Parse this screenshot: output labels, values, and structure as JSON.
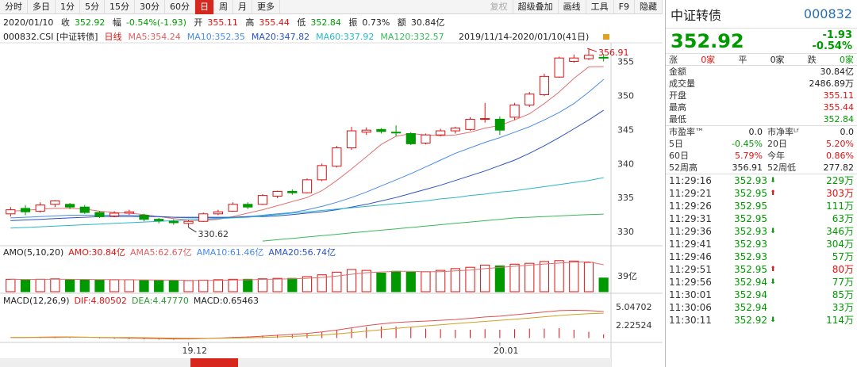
{
  "toolbar": {
    "items": [
      "分时",
      "多日",
      "1分",
      "5分",
      "15分",
      "30分",
      "60分",
      "日",
      "周",
      "月",
      "更多"
    ],
    "right": [
      "复权",
      "超级叠加",
      "画线",
      "工具",
      "F9",
      "隐藏"
    ]
  },
  "info": {
    "date": "2020/01/10",
    "close_label": "收",
    "close": "352.92",
    "range_label": "幅",
    "range": "-0.54%(-1.93)",
    "open_label": "开",
    "open": "355.11",
    "high_label": "高",
    "high": "355.44",
    "low_label": "低",
    "low": "352.84",
    "amp_label": "振",
    "amp": "0.73%",
    "amt_label": "额",
    "amt": "30.84亿"
  },
  "ma": {
    "code": "000832.CSI [中证转债]",
    "type": "日线",
    "ma5": "MA5:354.24",
    "ma10": "MA10:352.35",
    "ma20": "MA20:347.82",
    "ma60": "MA60:337.92",
    "ma120": "MA120:332.57",
    "range": "2019/11/14-2020/01/10(41日)"
  },
  "chart_data": {
    "type": "candlestick",
    "y_ticks": [
      355,
      350,
      345,
      340,
      335,
      330
    ],
    "ylim": [
      328.5,
      357.5
    ],
    "max_label": "356.91",
    "min_label": "330.62",
    "candles": [
      {
        "o": 332.6,
        "c": 333.2,
        "h": 333.6,
        "l": 332.2
      },
      {
        "o": 333.4,
        "c": 332.9,
        "h": 333.9,
        "l": 332.4
      },
      {
        "o": 333.0,
        "c": 333.9,
        "h": 334.3,
        "l": 332.8
      },
      {
        "o": 334.0,
        "c": 334.5,
        "h": 334.6,
        "l": 333.6
      },
      {
        "o": 334.0,
        "c": 333.6,
        "h": 334.2,
        "l": 333.3
      },
      {
        "o": 333.6,
        "c": 332.8,
        "h": 333.9,
        "l": 332.6
      },
      {
        "o": 332.8,
        "c": 332.2,
        "h": 333.0,
        "l": 332.0
      },
      {
        "o": 332.3,
        "c": 332.7,
        "h": 333.0,
        "l": 332.1
      },
      {
        "o": 332.7,
        "c": 332.9,
        "h": 333.2,
        "l": 332.4
      },
      {
        "o": 332.4,
        "c": 331.8,
        "h": 332.6,
        "l": 331.5
      },
      {
        "o": 331.8,
        "c": 331.6,
        "h": 332.0,
        "l": 331.2
      },
      {
        "o": 331.5,
        "c": 331.3,
        "h": 331.8,
        "l": 331.0
      },
      {
        "o": 331.2,
        "c": 331.5,
        "h": 331.7,
        "l": 330.6
      },
      {
        "o": 331.5,
        "c": 332.6,
        "h": 332.8,
        "l": 331.4
      },
      {
        "o": 332.6,
        "c": 332.9,
        "h": 333.2,
        "l": 332.4
      },
      {
        "o": 333.0,
        "c": 334.0,
        "h": 334.3,
        "l": 332.9
      },
      {
        "o": 334.0,
        "c": 333.6,
        "h": 334.3,
        "l": 333.3
      },
      {
        "o": 334.0,
        "c": 335.3,
        "h": 335.5,
        "l": 333.9
      },
      {
        "o": 335.2,
        "c": 335.9,
        "h": 336.0,
        "l": 334.9
      },
      {
        "o": 335.9,
        "c": 335.7,
        "h": 336.2,
        "l": 335.4
      },
      {
        "o": 335.7,
        "c": 337.6,
        "h": 337.8,
        "l": 335.6
      },
      {
        "o": 337.6,
        "c": 339.7,
        "h": 340.0,
        "l": 337.4
      },
      {
        "o": 339.6,
        "c": 342.3,
        "h": 342.6,
        "l": 339.4
      },
      {
        "o": 342.3,
        "c": 344.8,
        "h": 345.4,
        "l": 342.0
      },
      {
        "o": 344.6,
        "c": 344.9,
        "h": 345.3,
        "l": 344.2
      },
      {
        "o": 345.0,
        "c": 344.7,
        "h": 345.2,
        "l": 344.4
      },
      {
        "o": 344.6,
        "c": 344.5,
        "h": 345.6,
        "l": 344.0
      },
      {
        "o": 344.4,
        "c": 342.9,
        "h": 344.6,
        "l": 342.7
      },
      {
        "o": 343.0,
        "c": 344.2,
        "h": 344.4,
        "l": 342.8
      },
      {
        "o": 344.2,
        "c": 344.8,
        "h": 345.1,
        "l": 344.0
      },
      {
        "o": 344.8,
        "c": 345.2,
        "h": 345.4,
        "l": 344.4
      },
      {
        "o": 345.0,
        "c": 346.5,
        "h": 346.8,
        "l": 344.8
      },
      {
        "o": 346.5,
        "c": 346.6,
        "h": 348.9,
        "l": 346.0
      },
      {
        "o": 346.5,
        "c": 344.9,
        "h": 346.9,
        "l": 344.2
      },
      {
        "o": 346.8,
        "c": 348.6,
        "h": 348.9,
        "l": 346.4
      },
      {
        "o": 348.6,
        "c": 350.2,
        "h": 350.5,
        "l": 348.3
      },
      {
        "o": 350.1,
        "c": 352.8,
        "h": 353.2,
        "l": 349.9
      },
      {
        "o": 352.7,
        "c": 355.5,
        "h": 355.7,
        "l": 352.6
      },
      {
        "o": 355.0,
        "c": 355.5,
        "h": 356.0,
        "l": 354.8
      },
      {
        "o": 355.4,
        "c": 355.9,
        "h": 356.91,
        "l": 355.2
      },
      {
        "o": 355.6,
        "c": 355.5,
        "h": 356.1,
        "l": 355.0
      }
    ],
    "ma_lines": [
      {
        "name": "MA5",
        "color": "#e07070",
        "values": [
          333,
          333.1,
          333.3,
          333.4,
          333.4,
          333.3,
          333,
          332.8,
          332.7,
          332.5,
          332.2,
          331.9,
          331.7,
          331.6,
          331.8,
          332.2,
          332.7,
          333.2,
          333.8,
          334.4,
          335,
          336,
          337.5,
          339.2,
          341,
          342.8,
          344,
          344.4,
          344.2,
          344.1,
          344.2,
          344.6,
          345.2,
          345.6,
          346.4,
          347.3,
          348.8,
          350.5,
          352.5,
          354.2,
          354.24
        ]
      },
      {
        "name": "MA10",
        "color": "#4a8ae8",
        "values": [
          332,
          332.1,
          332.2,
          332.3,
          332.4,
          332.4,
          332.4,
          332.4,
          332.4,
          332.3,
          332.2,
          332.1,
          332,
          332,
          332,
          332.1,
          332.2,
          332.4,
          332.6,
          332.8,
          333.2,
          333.7,
          334.3,
          335,
          335.8,
          336.7,
          337.6,
          338.5,
          339.5,
          340.5,
          341.5,
          342.3,
          343.1,
          343.8,
          344.6,
          345.4,
          346.4,
          347.5,
          348.8,
          350.5,
          352.35
        ]
      },
      {
        "name": "MA20",
        "color": "#2a52c4",
        "values": [
          331.6,
          331.7,
          331.8,
          331.9,
          332,
          332.1,
          332.2,
          332.2,
          332.2,
          332.2,
          332.2,
          332.1,
          332.1,
          332.1,
          332.1,
          332.1,
          332.2,
          332.2,
          332.3,
          332.5,
          332.7,
          332.9,
          333.2,
          333.6,
          334,
          334.5,
          335,
          335.6,
          336.2,
          336.8,
          337.5,
          338.2,
          338.9,
          339.7,
          340.5,
          341.5,
          342.6,
          343.8,
          345.1,
          346.4,
          347.82
        ]
      },
      {
        "name": "MA60",
        "color": "#2ab6c8",
        "values": [
          330.5,
          330.6,
          330.7,
          330.8,
          330.9,
          331,
          331.1,
          331.2,
          331.3,
          331.4,
          331.5,
          331.6,
          331.7,
          331.8,
          331.9,
          332,
          332.1,
          332.3,
          332.5,
          332.7,
          332.9,
          333.1,
          333.3,
          333.5,
          333.7,
          333.9,
          334.1,
          334.3,
          334.5,
          334.8,
          335.0,
          335.3,
          335.5,
          335.8,
          336.0,
          336.3,
          336.6,
          336.9,
          337.2,
          337.5,
          337.92
        ]
      },
      {
        "name": "MA120",
        "color": "#3ab85a",
        "values": [
          null,
          null,
          null,
          null,
          null,
          null,
          null,
          null,
          null,
          null,
          null,
          null,
          null,
          null,
          null,
          null,
          null,
          328.6,
          328.8,
          329,
          329.2,
          329.4,
          329.6,
          329.8,
          330,
          330.2,
          330.4,
          330.6,
          330.8,
          331,
          331.2,
          331.4,
          331.6,
          331.8,
          332,
          332.1,
          332.2,
          332.3,
          332.4,
          332.5,
          332.57
        ]
      }
    ],
    "x_labels": [
      {
        "i": 12,
        "text": "19.12"
      },
      {
        "i": 33,
        "text": "20.01"
      }
    ],
    "amo": {
      "label": "AMO(5,10,20)",
      "amo": "AMO:30.84亿",
      "ma5": "AMA5:62.67亿",
      "ma10": "AMA10:61.46亿",
      "ma20": "AMA20:56.74亿",
      "tick": "39亿",
      "ymax": 75,
      "values": [
        28,
        27,
        28,
        29,
        27,
        27,
        26,
        27,
        27,
        26,
        25,
        25,
        25,
        26,
        27,
        28,
        28,
        29,
        30,
        30,
        34,
        38,
        44,
        50,
        48,
        42,
        46,
        44,
        45,
        48,
        52,
        55,
        60,
        58,
        62,
        64,
        68,
        70,
        69,
        66,
        30.84
      ]
    },
    "macd": {
      "label": "MACD(12,26,9)",
      "dif": "DIF:4.80502",
      "dea": "DEA:4.47770",
      "macd": "MACD:0.65463",
      "ticks": [
        "5.04702",
        "2.22524"
      ],
      "ymin": -0.5,
      "ymax": 5.5,
      "dif_values": [
        0.1,
        0.1,
        0.15,
        0.2,
        0.2,
        0.15,
        0.1,
        0.05,
        0.0,
        -0.05,
        -0.1,
        -0.15,
        -0.15,
        -0.1,
        0.0,
        0.1,
        0.2,
        0.35,
        0.5,
        0.65,
        0.85,
        1.1,
        1.45,
        1.85,
        2.25,
        2.55,
        2.8,
        2.95,
        3.05,
        3.2,
        3.35,
        3.55,
        3.8,
        3.95,
        4.2,
        4.45,
        4.7,
        4.95,
        5.0,
        4.95,
        4.8
      ],
      "dea_values": [
        0.1,
        0.1,
        0.1,
        0.12,
        0.14,
        0.14,
        0.13,
        0.12,
        0.1,
        0.07,
        0.04,
        0.0,
        -0.03,
        -0.05,
        -0.04,
        0.0,
        0.05,
        0.12,
        0.2,
        0.3,
        0.42,
        0.56,
        0.75,
        0.98,
        1.25,
        1.5,
        1.75,
        1.98,
        2.2,
        2.4,
        2.6,
        2.8,
        3.0,
        3.2,
        3.4,
        3.6,
        3.85,
        4.05,
        4.25,
        4.38,
        4.48
      ]
    }
  },
  "right": {
    "name": "中证转债",
    "code": "000832",
    "price": "352.92",
    "chg": "-1.93",
    "pct": "-0.54%",
    "updown": [
      {
        "label": "涨",
        "val": "0家"
      },
      {
        "label": "平",
        "val": "0家"
      },
      {
        "label": "跌",
        "val": "0家"
      }
    ],
    "stats": [
      {
        "label": "金额",
        "val": "30.84亿",
        "c": "cv"
      },
      {
        "label": "成交量",
        "val": "2486.89万",
        "c": "cv"
      },
      {
        "label": "开盘",
        "val": "355.11",
        "c": "up"
      },
      {
        "label": "最高",
        "val": "355.44",
        "c": "up"
      },
      {
        "label": "最低",
        "val": "352.84",
        "c": "dn"
      }
    ],
    "pe": [
      {
        "a": "市盈率™",
        "b": "0.0",
        "c": "市净率ᴸᶠ",
        "d": "0.0"
      },
      {
        "a": "5日",
        "b": "-0.45%",
        "c": "20日",
        "d": "5.20%"
      },
      {
        "a": "60日",
        "b": "5.79%",
        "c": "今年",
        "d": "0.86%"
      },
      {
        "a": "52周高",
        "b": "356.91",
        "c": "52周低",
        "d": "277.82"
      }
    ],
    "ticks": [
      {
        "t": "11:29:16",
        "p": "352.93",
        "a": "down",
        "v": "229万"
      },
      {
        "t": "11:29:21",
        "p": "352.95",
        "a": "up",
        "v": "303万"
      },
      {
        "t": "11:29:26",
        "p": "352.95",
        "a": "",
        "v": "111万"
      },
      {
        "t": "11:29:31",
        "p": "352.95",
        "a": "",
        "v": "63万"
      },
      {
        "t": "11:29:36",
        "p": "352.93",
        "a": "down",
        "v": "346万"
      },
      {
        "t": "11:29:41",
        "p": "352.93",
        "a": "",
        "v": "304万"
      },
      {
        "t": "11:29:46",
        "p": "352.93",
        "a": "",
        "v": "57万"
      },
      {
        "t": "11:29:51",
        "p": "352.95",
        "a": "up",
        "v": "80万"
      },
      {
        "t": "11:29:56",
        "p": "352.94",
        "a": "down",
        "v": "77万"
      },
      {
        "t": "11:30:01",
        "p": "352.94",
        "a": "",
        "v": "85万"
      },
      {
        "t": "11:30:06",
        "p": "352.94",
        "a": "",
        "v": "33万"
      },
      {
        "t": "11:30:11",
        "p": "352.92",
        "a": "down",
        "v": "114万"
      }
    ]
  }
}
